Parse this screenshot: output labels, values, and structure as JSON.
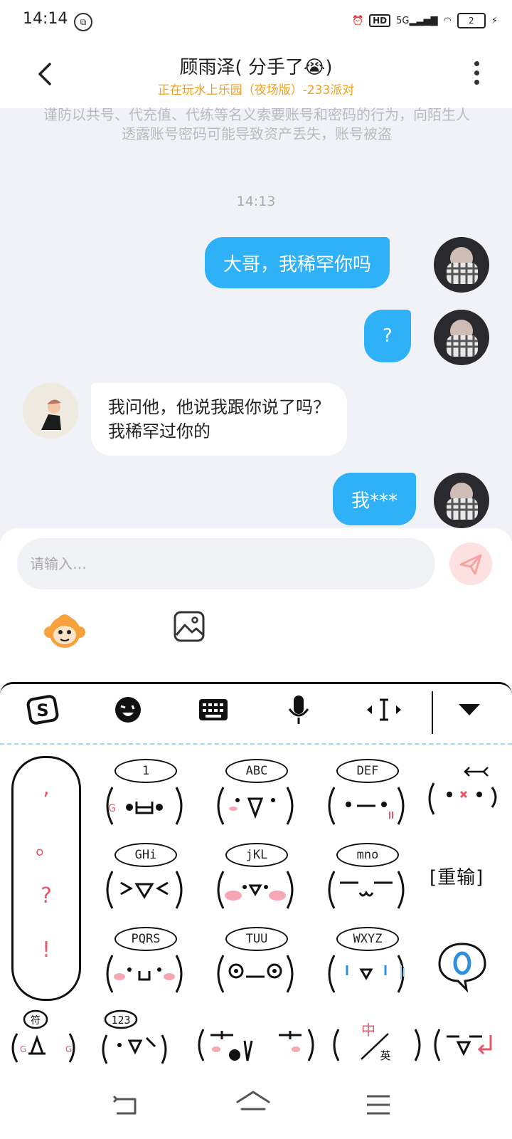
{
  "status": {
    "time": "14:14",
    "hd": "HD",
    "net": "5G",
    "battery": "2"
  },
  "header": {
    "title": "顾雨泽( 分手了😭)",
    "subtitle": "正在玩水上乐园（夜场版）-233派对"
  },
  "chat": {
    "notice": "谨防以共号、代充值、代练等名义索要账号和密码的行为，向陌生人透露账号密码可能导致资产丢失，账号被盗",
    "timestamp": "14:13",
    "messages": [
      {
        "side": "right",
        "text": "大哥，我稀罕你吗"
      },
      {
        "side": "right",
        "text": "?"
      },
      {
        "side": "left",
        "line1": "我问他，他说我跟你说了吗？",
        "line2": "我稀罕过你的"
      },
      {
        "side": "right",
        "text": "我***"
      }
    ]
  },
  "input": {
    "placeholder": "请输入…"
  },
  "keyboard": {
    "side_keys": [
      ",",
      "。",
      "?",
      "!"
    ],
    "keys": [
      "1",
      "ABC",
      "DEF",
      "GHi",
      "jKL",
      "mno",
      "PQRS",
      "TUU",
      "WXYZ"
    ],
    "reinput": "[重输]",
    "row4": {
      "symbol": "符",
      "num": "123",
      "lang_top": "中",
      "lang_bottom": "英"
    }
  },
  "colors": {
    "accent": "#2eb1f7",
    "subtitle": "#f0a020",
    "send": "#f5a4a4"
  }
}
